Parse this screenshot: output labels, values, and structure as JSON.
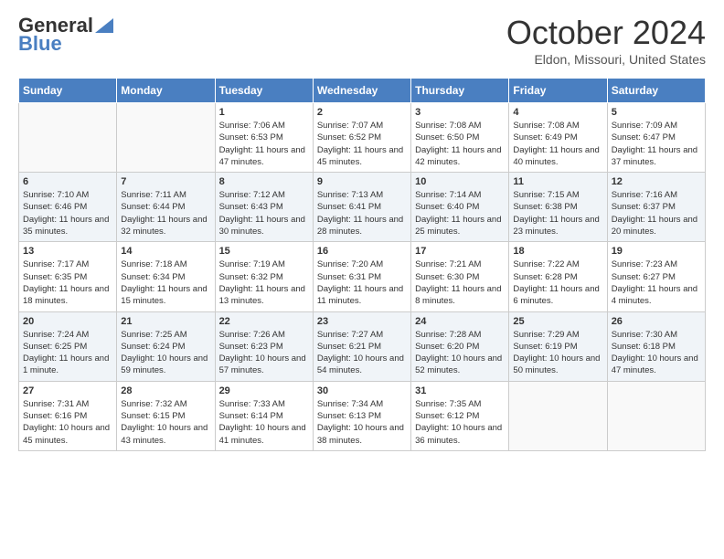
{
  "header": {
    "logo_general": "General",
    "logo_blue": "Blue",
    "title": "October 2024",
    "location": "Eldon, Missouri, United States"
  },
  "days_of_week": [
    "Sunday",
    "Monday",
    "Tuesday",
    "Wednesday",
    "Thursday",
    "Friday",
    "Saturday"
  ],
  "weeks": [
    [
      {
        "day": "",
        "info": ""
      },
      {
        "day": "",
        "info": ""
      },
      {
        "day": "1",
        "info": "Sunrise: 7:06 AM\nSunset: 6:53 PM\nDaylight: 11 hours and 47 minutes."
      },
      {
        "day": "2",
        "info": "Sunrise: 7:07 AM\nSunset: 6:52 PM\nDaylight: 11 hours and 45 minutes."
      },
      {
        "day": "3",
        "info": "Sunrise: 7:08 AM\nSunset: 6:50 PM\nDaylight: 11 hours and 42 minutes."
      },
      {
        "day": "4",
        "info": "Sunrise: 7:08 AM\nSunset: 6:49 PM\nDaylight: 11 hours and 40 minutes."
      },
      {
        "day": "5",
        "info": "Sunrise: 7:09 AM\nSunset: 6:47 PM\nDaylight: 11 hours and 37 minutes."
      }
    ],
    [
      {
        "day": "6",
        "info": "Sunrise: 7:10 AM\nSunset: 6:46 PM\nDaylight: 11 hours and 35 minutes."
      },
      {
        "day": "7",
        "info": "Sunrise: 7:11 AM\nSunset: 6:44 PM\nDaylight: 11 hours and 32 minutes."
      },
      {
        "day": "8",
        "info": "Sunrise: 7:12 AM\nSunset: 6:43 PM\nDaylight: 11 hours and 30 minutes."
      },
      {
        "day": "9",
        "info": "Sunrise: 7:13 AM\nSunset: 6:41 PM\nDaylight: 11 hours and 28 minutes."
      },
      {
        "day": "10",
        "info": "Sunrise: 7:14 AM\nSunset: 6:40 PM\nDaylight: 11 hours and 25 minutes."
      },
      {
        "day": "11",
        "info": "Sunrise: 7:15 AM\nSunset: 6:38 PM\nDaylight: 11 hours and 23 minutes."
      },
      {
        "day": "12",
        "info": "Sunrise: 7:16 AM\nSunset: 6:37 PM\nDaylight: 11 hours and 20 minutes."
      }
    ],
    [
      {
        "day": "13",
        "info": "Sunrise: 7:17 AM\nSunset: 6:35 PM\nDaylight: 11 hours and 18 minutes."
      },
      {
        "day": "14",
        "info": "Sunrise: 7:18 AM\nSunset: 6:34 PM\nDaylight: 11 hours and 15 minutes."
      },
      {
        "day": "15",
        "info": "Sunrise: 7:19 AM\nSunset: 6:32 PM\nDaylight: 11 hours and 13 minutes."
      },
      {
        "day": "16",
        "info": "Sunrise: 7:20 AM\nSunset: 6:31 PM\nDaylight: 11 hours and 11 minutes."
      },
      {
        "day": "17",
        "info": "Sunrise: 7:21 AM\nSunset: 6:30 PM\nDaylight: 11 hours and 8 minutes."
      },
      {
        "day": "18",
        "info": "Sunrise: 7:22 AM\nSunset: 6:28 PM\nDaylight: 11 hours and 6 minutes."
      },
      {
        "day": "19",
        "info": "Sunrise: 7:23 AM\nSunset: 6:27 PM\nDaylight: 11 hours and 4 minutes."
      }
    ],
    [
      {
        "day": "20",
        "info": "Sunrise: 7:24 AM\nSunset: 6:25 PM\nDaylight: 11 hours and 1 minute."
      },
      {
        "day": "21",
        "info": "Sunrise: 7:25 AM\nSunset: 6:24 PM\nDaylight: 10 hours and 59 minutes."
      },
      {
        "day": "22",
        "info": "Sunrise: 7:26 AM\nSunset: 6:23 PM\nDaylight: 10 hours and 57 minutes."
      },
      {
        "day": "23",
        "info": "Sunrise: 7:27 AM\nSunset: 6:21 PM\nDaylight: 10 hours and 54 minutes."
      },
      {
        "day": "24",
        "info": "Sunrise: 7:28 AM\nSunset: 6:20 PM\nDaylight: 10 hours and 52 minutes."
      },
      {
        "day": "25",
        "info": "Sunrise: 7:29 AM\nSunset: 6:19 PM\nDaylight: 10 hours and 50 minutes."
      },
      {
        "day": "26",
        "info": "Sunrise: 7:30 AM\nSunset: 6:18 PM\nDaylight: 10 hours and 47 minutes."
      }
    ],
    [
      {
        "day": "27",
        "info": "Sunrise: 7:31 AM\nSunset: 6:16 PM\nDaylight: 10 hours and 45 minutes."
      },
      {
        "day": "28",
        "info": "Sunrise: 7:32 AM\nSunset: 6:15 PM\nDaylight: 10 hours and 43 minutes."
      },
      {
        "day": "29",
        "info": "Sunrise: 7:33 AM\nSunset: 6:14 PM\nDaylight: 10 hours and 41 minutes."
      },
      {
        "day": "30",
        "info": "Sunrise: 7:34 AM\nSunset: 6:13 PM\nDaylight: 10 hours and 38 minutes."
      },
      {
        "day": "31",
        "info": "Sunrise: 7:35 AM\nSunset: 6:12 PM\nDaylight: 10 hours and 36 minutes."
      },
      {
        "day": "",
        "info": ""
      },
      {
        "day": "",
        "info": ""
      }
    ]
  ]
}
